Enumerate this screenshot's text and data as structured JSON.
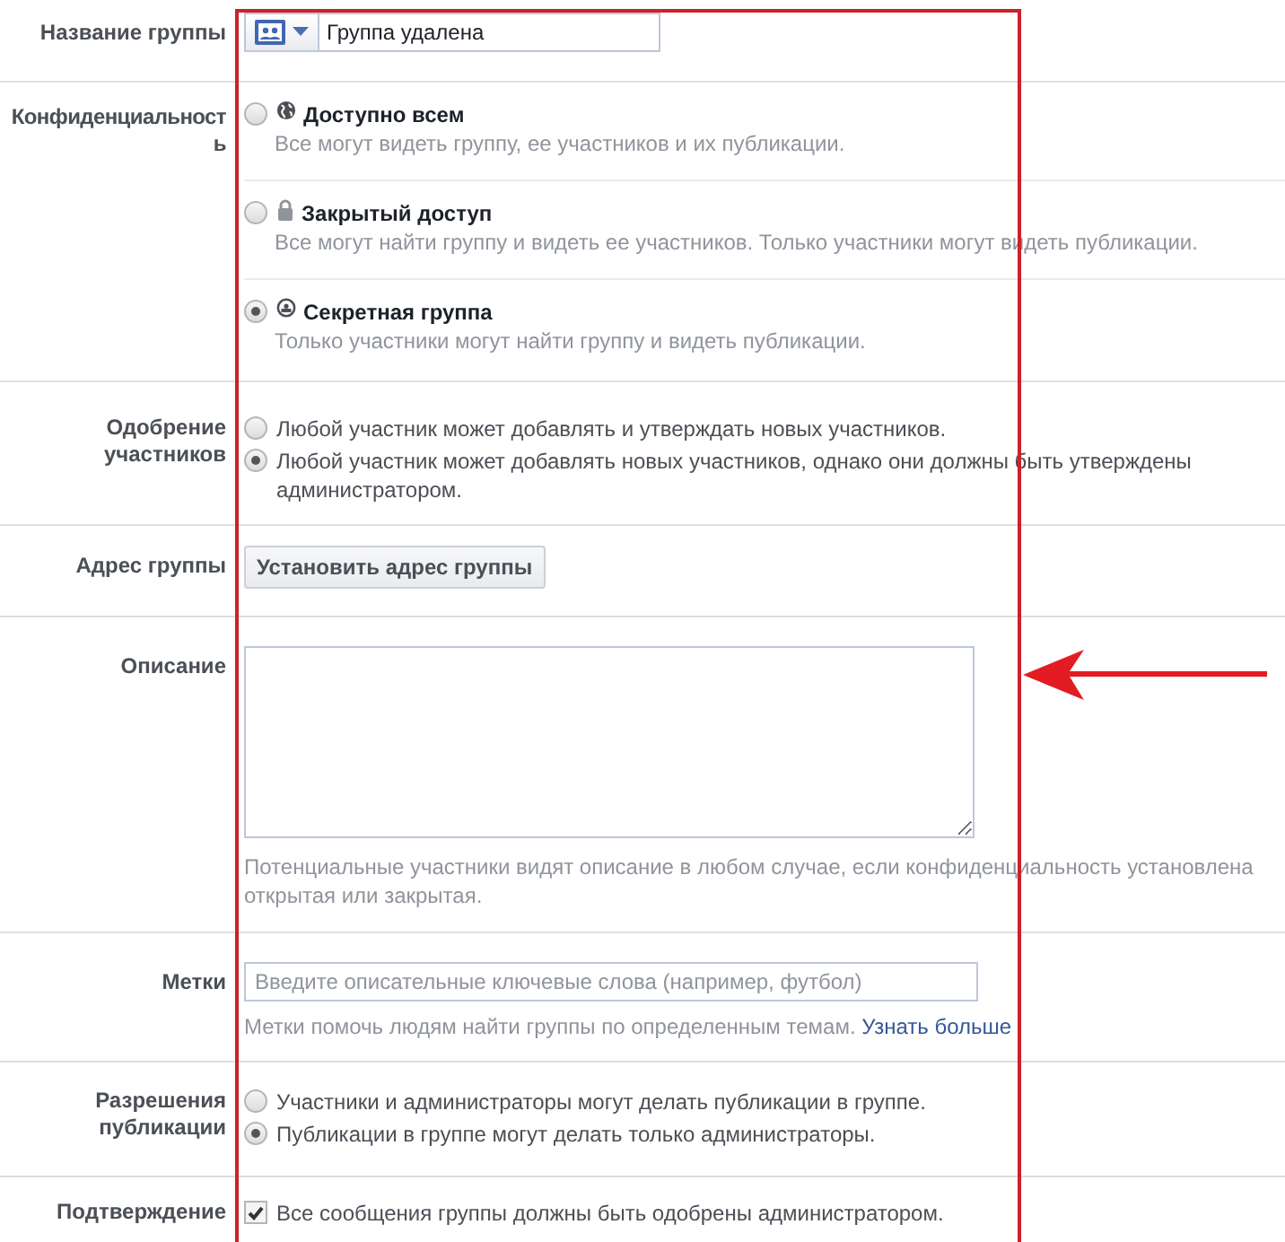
{
  "group_name": {
    "label": "Название группы",
    "value": "Группа удалена"
  },
  "privacy": {
    "label": "Конфиденциальность",
    "options": [
      {
        "kind": "globe",
        "title": "Доступно всем",
        "description": "Все могут видеть группу, ее участников и их публикации.",
        "selected": false
      },
      {
        "kind": "lock",
        "title": "Закрытый доступ",
        "description": "Все могут найти группу и видеть ее участников. Только участники могут видеть публикации.",
        "selected": false
      },
      {
        "kind": "secret",
        "title": "Секретная группа",
        "description": "Только участники могут найти группу и видеть публикации.",
        "selected": true
      }
    ]
  },
  "member_approval": {
    "label": "Одобрение участников",
    "options": [
      {
        "text": "Любой участник может добавлять и утверждать новых участников.",
        "selected": false
      },
      {
        "text": "Любой участник может добавлять новых участников, однако они должны быть утверждены администратором.",
        "selected": true
      }
    ]
  },
  "group_address": {
    "label": "Адрес группы",
    "button": "Установить адрес группы"
  },
  "description": {
    "label": "Описание",
    "hint": "Потенциальные участники видят описание в любом случае, если конфиденциальность установлена открытая или закрытая."
  },
  "tags": {
    "label": "Метки",
    "placeholder": "Введите описательные ключевые слова (например, футбол)",
    "hint": "Метки помочь людям найти группы по определенным темам.",
    "link": "Узнать больше"
  },
  "post_permissions": {
    "label": "Разрешения публикации",
    "options": [
      {
        "text": "Участники и администраторы могут делать публикации в группе.",
        "selected": false
      },
      {
        "text": "Публикации в группе могут делать только администраторы.",
        "selected": true
      }
    ]
  },
  "post_approval": {
    "label": "Подтверждение",
    "checkbox": {
      "text": "Все сообщения группы должны быть одобрены администратором.",
      "checked": true
    }
  },
  "annotation": {
    "frame": true,
    "arrow": true
  }
}
